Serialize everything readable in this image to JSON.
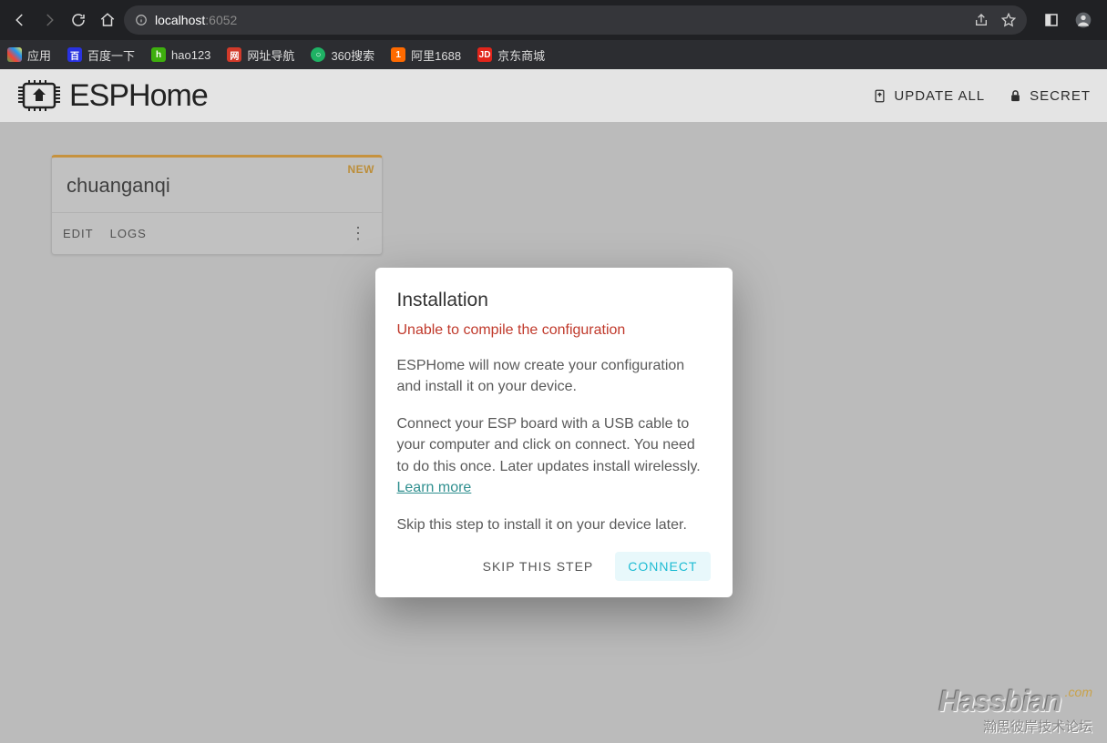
{
  "browser": {
    "url_host": "localhost",
    "url_port": ":6052",
    "bookmarks": [
      {
        "label": "应用"
      },
      {
        "label": "百度一下"
      },
      {
        "label": "hao123"
      },
      {
        "label": "网址导航"
      },
      {
        "label": "360搜索"
      },
      {
        "label": "阿里1688"
      },
      {
        "label": "京东商城"
      }
    ]
  },
  "header": {
    "app_name": "ESPHome",
    "update_all_label": "UPDATE ALL",
    "secrets_label": "SECRET"
  },
  "device_card": {
    "name": "chuanganqi",
    "new_badge": "NEW",
    "edit_label": "EDIT",
    "logs_label": "LOGS"
  },
  "modal": {
    "title": "Installation",
    "error": "Unable to compile the configuration",
    "p1": "ESPHome will now create your configuration and install it on your device.",
    "p2_a": "Connect your ESP board with a USB cable to your computer and click on connect. You need to do this once. Later updates install wirelessly. ",
    "learn_more": "Learn more",
    "p3": "Skip this step to install it on your device later.",
    "skip_label": "SKIP THIS STEP",
    "connect_label": "CONNECT"
  },
  "watermark": {
    "main": "Hassbian",
    "tld": ".com",
    "sub": "瀚思彼岸技术论坛"
  }
}
